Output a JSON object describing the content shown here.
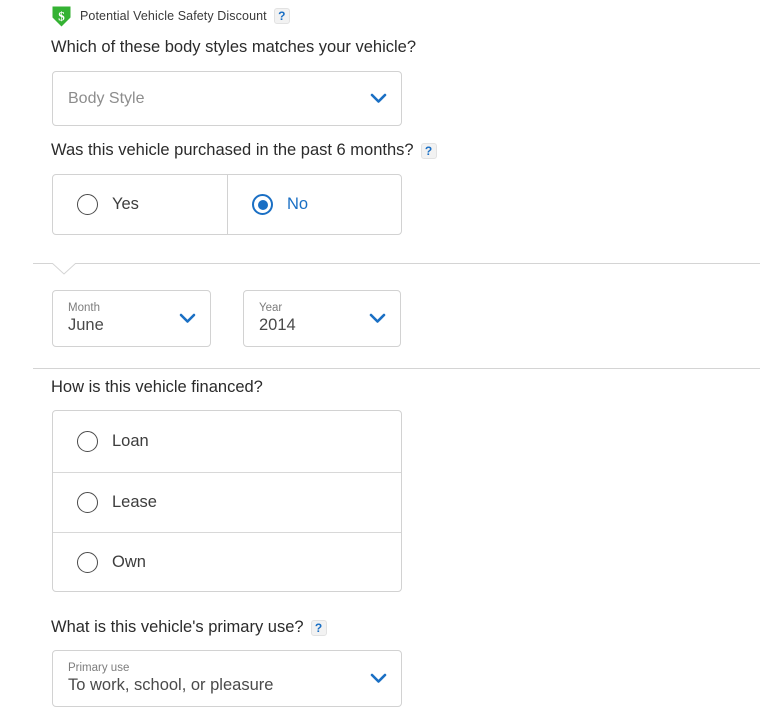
{
  "banner": {
    "badge_icon": "shield-dollar-icon",
    "badge_color": "#34b233",
    "label": "Potential Vehicle Safety Discount",
    "help_icon": "?"
  },
  "accent_color": "#1a6fc4",
  "sections": {
    "body_style": {
      "question": "Which of these body styles matches your vehicle?",
      "select": {
        "placeholder": "Body Style",
        "value": "",
        "chevron_icon": "chevron-down-icon"
      }
    },
    "purchased": {
      "question": "Was this vehicle purchased in the past 6 months?",
      "help_icon": "?",
      "options": [
        {
          "label": "Yes",
          "selected": false
        },
        {
          "label": "No",
          "selected": true
        }
      ]
    },
    "purchase_date": {
      "month": {
        "label": "Month",
        "value": "June",
        "chevron_icon": "chevron-down-icon"
      },
      "year": {
        "label": "Year",
        "value": "2014",
        "chevron_icon": "chevron-down-icon"
      }
    },
    "financed": {
      "question": "How is this vehicle financed?",
      "options": [
        {
          "label": "Loan",
          "selected": false
        },
        {
          "label": "Lease",
          "selected": false
        },
        {
          "label": "Own",
          "selected": false
        }
      ]
    },
    "primary_use": {
      "question": "What is this vehicle's primary use?",
      "help_icon": "?",
      "select": {
        "label": "Primary use",
        "value": "To work, school, or pleasure",
        "chevron_icon": "chevron-down-icon"
      }
    }
  }
}
